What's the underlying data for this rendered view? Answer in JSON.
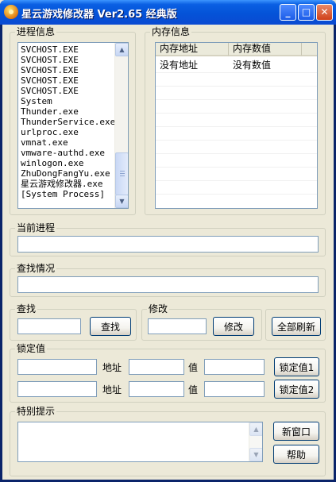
{
  "window": {
    "title": "星云游戏修改器 Ver2.65 经典版",
    "minimize_glyph": "_",
    "maximize_glyph": "□",
    "close_glyph": "✕"
  },
  "process_panel": {
    "label": "进程信息",
    "items": [
      "SVCHOST.EXE",
      "SVCHOST.EXE",
      "SVCHOST.EXE",
      "SVCHOST.EXE",
      "SVCHOST.EXE",
      "System",
      "Thunder.exe",
      "ThunderService.exe",
      "urlproc.exe",
      "vmnat.exe",
      "vmware-authd.exe",
      "winlogon.exe",
      "ZhuDongFangYu.exe",
      "星云游戏修改器.exe",
      "[System Process]"
    ]
  },
  "memory_panel": {
    "label": "内存信息",
    "columns": [
      "内存地址",
      "内存数值"
    ],
    "rows": [
      [
        "没有地址",
        "没有数值"
      ]
    ]
  },
  "current_process": {
    "label": "当前进程",
    "value": ""
  },
  "search_status": {
    "label": "查找情况",
    "value": ""
  },
  "search": {
    "label": "查找",
    "value": "",
    "button": "查找"
  },
  "modify": {
    "label": "修改",
    "value": "",
    "button": "修改"
  },
  "refresh_all_button": "全部刷新",
  "lock": {
    "label": "锁定值",
    "address_label": "地址",
    "value_label": "值",
    "rows": [
      {
        "name": "",
        "address": "",
        "value": "",
        "button": "锁定值1"
      },
      {
        "name": "",
        "address": "",
        "value": "",
        "button": "锁定值2"
      }
    ]
  },
  "notice": {
    "label": "特别提示",
    "text": "",
    "new_window_button": "新窗口",
    "help_button": "帮助"
  },
  "colors": {
    "title_bar": "#0453d8",
    "face": "#ece9d8",
    "input_border": "#7f9db9",
    "button_border": "#003c74"
  }
}
